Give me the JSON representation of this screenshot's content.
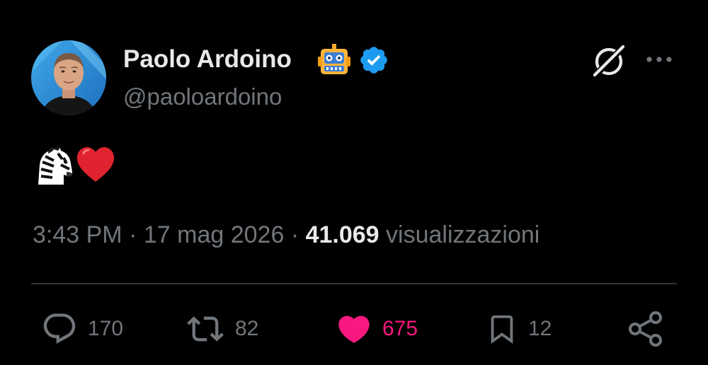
{
  "author": {
    "display_name": "Paolo Ardoino",
    "name_emoji": "robot-face-emoji",
    "handle": "@paoloardoino",
    "verified": true
  },
  "tweet": {
    "content_emojis": [
      "zebra-emoji",
      "red-heart-emoji"
    ],
    "time": "3:43 PM",
    "date": "17 mag 2026",
    "separator": "·",
    "views_count": "41.069",
    "views_label": "visualizzazioni"
  },
  "actions": {
    "reply_count": "170",
    "retweet_count": "82",
    "like_count": "675",
    "bookmark_count": "12"
  },
  "colors": {
    "background": "#000000",
    "primary_text": "#e7e9ea",
    "secondary_text": "#71767b",
    "verified_blue": "#1d9bf0",
    "like_pink": "#f91880",
    "divider": "#2f3336"
  },
  "icons": {
    "header": [
      "grok-icon",
      "more-icon"
    ],
    "actions": [
      "reply-icon",
      "retweet-icon",
      "heart-icon",
      "bookmark-icon",
      "share-icon"
    ]
  }
}
